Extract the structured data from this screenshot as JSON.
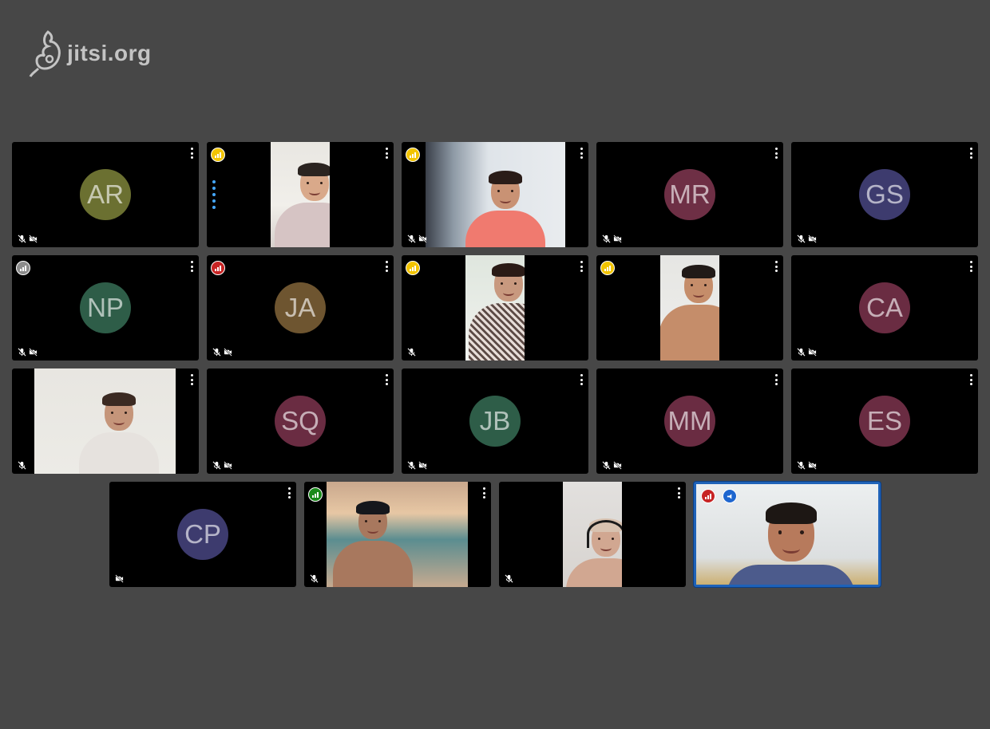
{
  "brand": {
    "logo_text": "jitsi.org"
  },
  "colors": {
    "background": "#474747",
    "tile": "#000000",
    "active_border": "#1f62b8",
    "quality_good": "#1a8a1a",
    "quality_medium": "#f2c400",
    "quality_poor": "#c72424",
    "quality_unknown": "#8c8c8c"
  },
  "participants": [
    {
      "initials": "AR",
      "avatar_color": "#6b7031",
      "video": false,
      "muted": true,
      "video_muted": true
    },
    {
      "initials": "",
      "video": true,
      "connection": "medium",
      "speaking": true,
      "muted": false,
      "video_muted": false,
      "scene": "teen-boy-bright"
    },
    {
      "initials": "",
      "video": true,
      "connection": "medium",
      "muted": true,
      "video_muted": true,
      "scene": "girl-room"
    },
    {
      "initials": "MR",
      "avatar_color": "#6e2f45",
      "video": false,
      "muted": true,
      "video_muted": true
    },
    {
      "initials": "GS",
      "avatar_color": "#3d3b6e",
      "video": false,
      "muted": true,
      "video_muted": true
    },
    {
      "initials": "NP",
      "avatar_color": "#2e5d48",
      "video": false,
      "connection": "unknown",
      "muted": true,
      "video_muted": true
    },
    {
      "initials": "JA",
      "avatar_color": "#6e5530",
      "video": false,
      "connection": "poor",
      "muted": true,
      "video_muted": true
    },
    {
      "initials": "",
      "video": true,
      "connection": "medium",
      "muted": true,
      "video_muted": false,
      "scene": "girl-glasses"
    },
    {
      "initials": "",
      "video": true,
      "connection": "medium",
      "muted": false,
      "video_muted": false,
      "scene": "boy-thumbs-up"
    },
    {
      "initials": "CA",
      "avatar_color": "#6a2c42",
      "video": false,
      "muted": true,
      "video_muted": true
    },
    {
      "initials": "",
      "video": true,
      "muted": true,
      "video_muted": false,
      "scene": "boy-smiling"
    },
    {
      "initials": "SQ",
      "avatar_color": "#6a2c42",
      "video": false,
      "muted": true,
      "video_muted": true
    },
    {
      "initials": "JB",
      "avatar_color": "#2e5d48",
      "video": false,
      "muted": true,
      "video_muted": true
    },
    {
      "initials": "MM",
      "avatar_color": "#6a2c42",
      "video": false,
      "muted": true,
      "video_muted": true
    },
    {
      "initials": "ES",
      "avatar_color": "#6a2c42",
      "video": false,
      "muted": true,
      "video_muted": true
    },
    {
      "initials": "CP",
      "avatar_color": "#3d3b6e",
      "video": false,
      "muted": false,
      "video_muted": true
    },
    {
      "initials": "",
      "video": true,
      "connection": "good",
      "muted": true,
      "video_muted": false,
      "scene": "boy-cap-bed"
    },
    {
      "initials": "",
      "video": true,
      "muted": true,
      "video_muted": false,
      "scene": "child-headphones"
    },
    {
      "initials": "",
      "video": true,
      "connection": "poor",
      "dominant_speaker": true,
      "active": true,
      "muted": false,
      "video_muted": false,
      "scene": "man-smiling"
    }
  ]
}
